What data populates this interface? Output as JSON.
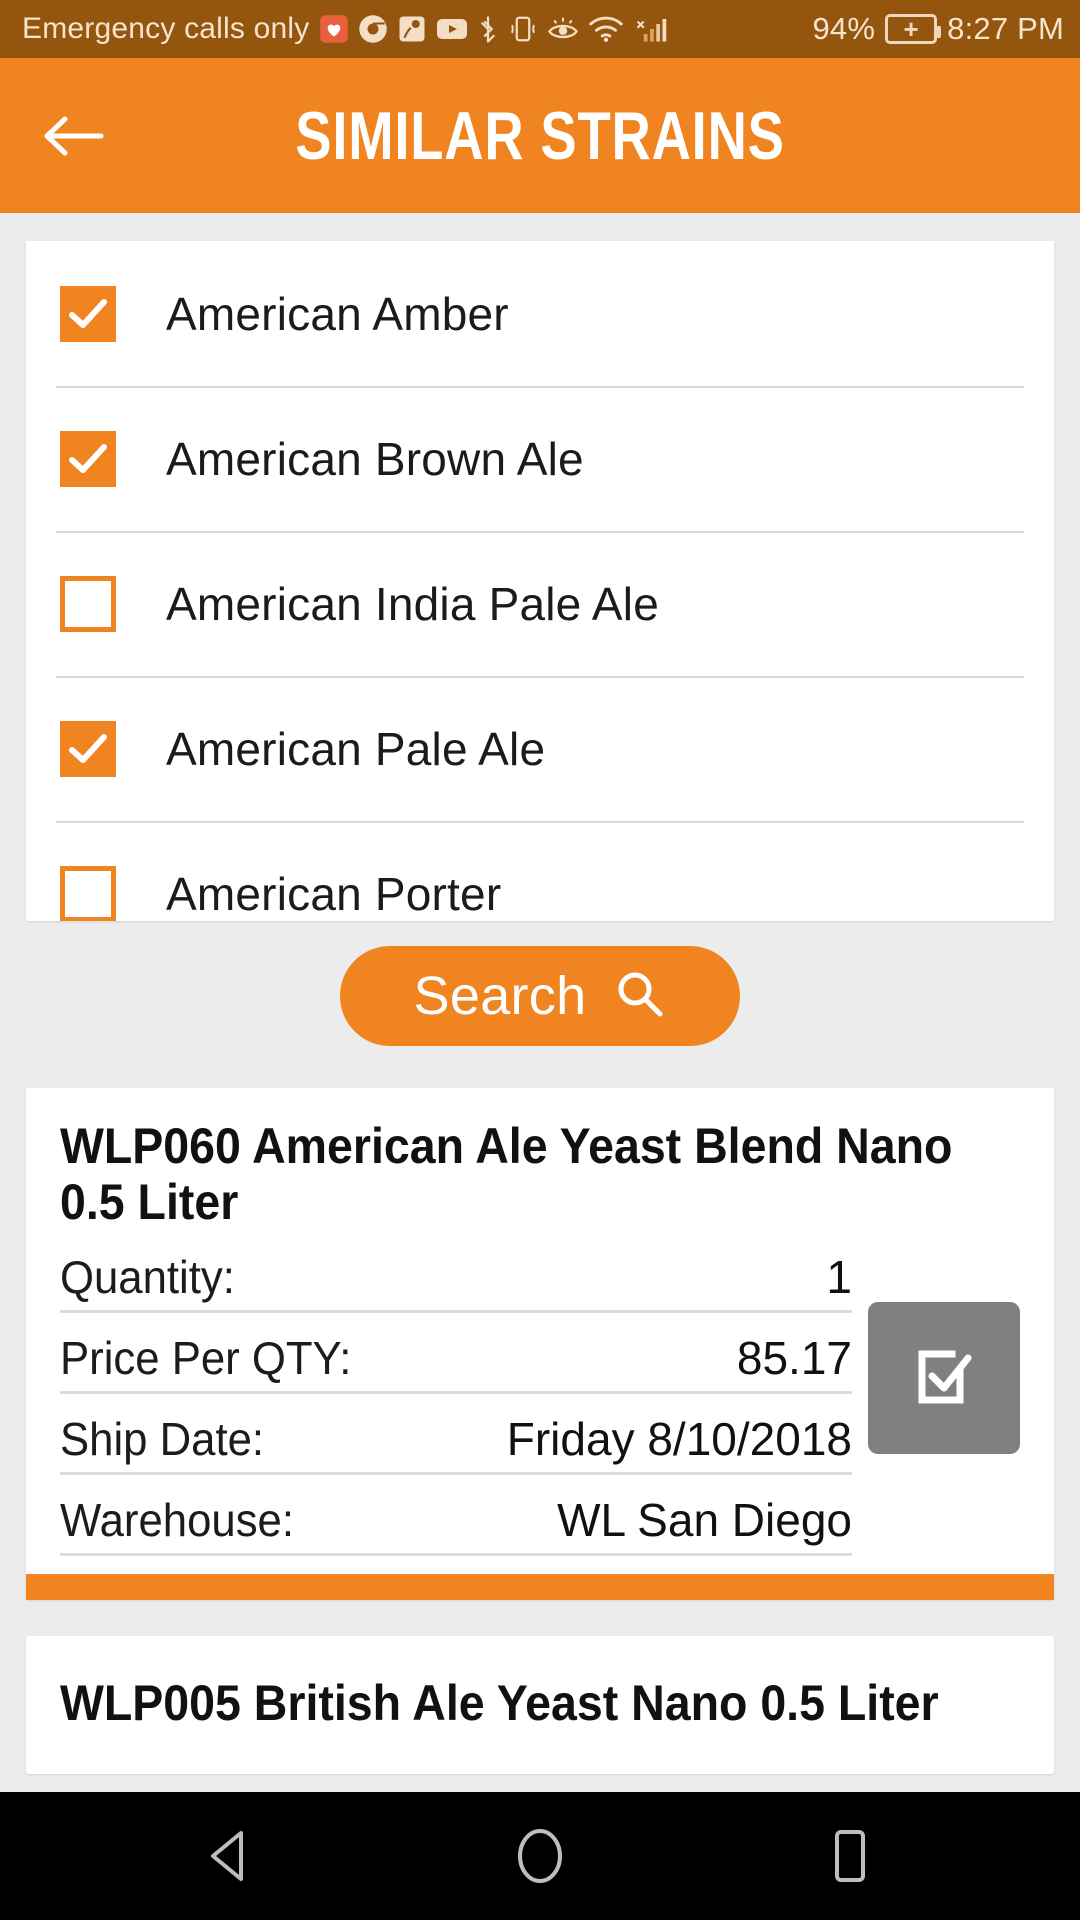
{
  "status_bar": {
    "carrier_text": "Emergency calls only",
    "battery_percent": "94%",
    "clock": "8:27 PM",
    "icons": [
      "heart-rate-icon",
      "chrome-icon",
      "maps-icon",
      "youtube-icon",
      "bluetooth-icon",
      "vibrate-icon",
      "eye-comfort-icon",
      "wifi-icon",
      "cellular-signal-icon",
      "battery-charging-icon"
    ],
    "background_color": "#94560f",
    "foreground_color": "#f6e3cc"
  },
  "app_bar": {
    "title": "SIMILAR STRAINS",
    "back_icon": "arrow-left-icon",
    "background_color": "#ef8420"
  },
  "strain_list": {
    "items": [
      {
        "label": "American Amber",
        "checked": true
      },
      {
        "label": "American Brown Ale",
        "checked": true
      },
      {
        "label": "American India Pale Ale",
        "checked": false
      },
      {
        "label": "American Pale Ale",
        "checked": true
      },
      {
        "label": "American Porter",
        "checked": false
      }
    ]
  },
  "search": {
    "label": "Search",
    "icon": "magnifier-icon"
  },
  "results": [
    {
      "title": "WLP060 American Ale Yeast Blend Nano 0.5 Liter",
      "details": [
        {
          "label": "Quantity:",
          "value": "1"
        },
        {
          "label": "Price Per QTY:",
          "value": "85.17"
        },
        {
          "label": "Ship Date:",
          "value": "Friday 8/10/2018"
        },
        {
          "label": "Warehouse:",
          "value": "WL San Diego"
        }
      ],
      "select_button_icon": "checkbox-select-icon",
      "accent_color": "#ef8420"
    },
    {
      "title": "WLP005 British Ale Yeast Nano 0.5 Liter"
    }
  ],
  "nav_bar": {
    "back_icon": "triangle-back-icon",
    "home_icon": "circle-home-icon",
    "recents_icon": "square-recents-icon"
  }
}
